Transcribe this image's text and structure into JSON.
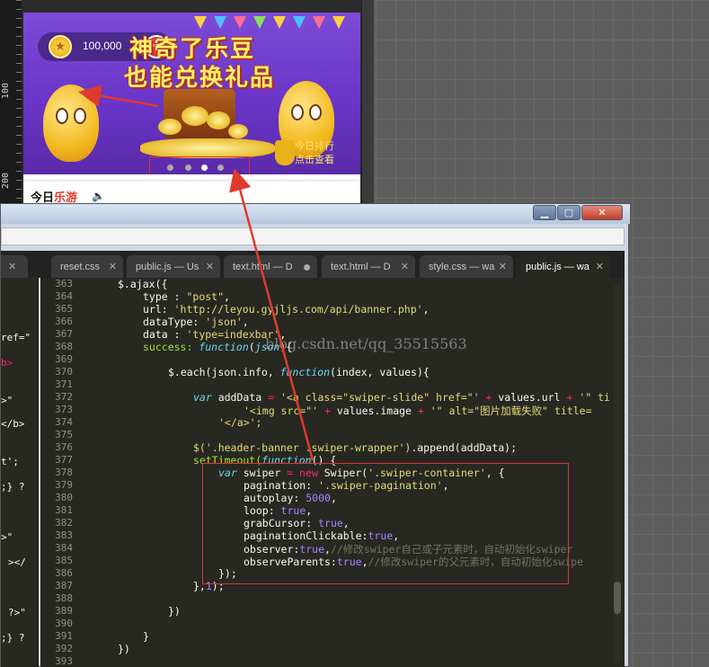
{
  "preview": {
    "ruler_labels": [
      "100",
      "200"
    ],
    "coin_value": "100,000",
    "title_line1": "神奇了乐豆",
    "title_line2": "也能兑换礼品",
    "rank_line1": "今日排行",
    "rank_line2": "点击查看",
    "logo_plain": "今日",
    "logo_red": "乐游"
  },
  "window": {
    "min_label": "▁",
    "max_label": "▢",
    "close_label": "✕"
  },
  "tabs": [
    {
      "label": "reset.css",
      "state": "close"
    },
    {
      "label": "public.js — Us",
      "state": "close"
    },
    {
      "label": "text.html — D",
      "state": "modified"
    },
    {
      "label": "text.html — D",
      "state": "close"
    },
    {
      "label": "style.css — wa",
      "state": "close"
    },
    {
      "label": "public.js — wa",
      "state": "active"
    }
  ],
  "left_fragments": [
    "ref=\"",
    "b>",
    ">\"",
    "</b>",
    "t';",
    ";} ?",
    ">\"",
    "></",
    "?>\"",
    ";} ?"
  ],
  "watermark": "blog.csdn.net/qq_35515563",
  "line_numbers": [
    "363",
    "364",
    "365",
    "366",
    "367",
    "368",
    "369",
    "370",
    "371",
    "372",
    "373",
    "374",
    "375",
    "376",
    "377",
    "378",
    "379",
    "380",
    "381",
    "382",
    "383",
    "384",
    "385",
    "386",
    "387",
    "388",
    "389",
    "390",
    "391",
    "392",
    "393"
  ],
  "code": {
    "l363": "$.ajax({",
    "l364_a": "type : ",
    "l364_b": "\"post\"",
    "l364_c": ",",
    "l365_a": "url: ",
    "l365_b": "'http://leyou.gyjljs.com/api/banner.php'",
    "l365_c": ",",
    "l366_a": "dataType: ",
    "l366_b": "'json'",
    "l366_c": ",",
    "l367_a": "data : ",
    "l367_b": "'type=indexbar'",
    "l367_c": ",",
    "l368_a": "success: ",
    "l368_b": "function",
    "l368_c": "(",
    "l368_d": "json",
    "l368_e": "){",
    "l370_a": "$.each(json.info, ",
    "l370_b": "function",
    "l370_c": "(index, values){",
    "l372_a": "var",
    "l372_b": " addData ",
    "l372_c": "=",
    "l372_d": " '<a class=\"swiper-slide\" href=\"' ",
    "l372_e": "+",
    "l372_f": " values.url ",
    "l372_g": "+",
    "l372_h": " '\" ti",
    "l373_a": "'<img src=\"' ",
    "l373_b": "+",
    "l373_c": " values.image ",
    "l373_d": "+",
    "l373_e": " '\" alt=\"图片加载失败\" title=",
    "l374": "'</a>';",
    "l376_a": "$('.header-banner .swiper-wrapper')",
    "l376_b": ".append(addData);",
    "l377_a": "setTimeout(",
    "l377_b": "function",
    "l377_c": "() {",
    "l378_a": "var",
    "l378_b": " swiper ",
    "l378_c": "=",
    "l378_d": " new",
    "l378_e": " Swiper(",
    "l378_f": "'.swiper-container'",
    "l378_g": ", {",
    "l379_a": "pagination: ",
    "l379_b": "'.swiper-pagination'",
    "l379_c": ",",
    "l380_a": "autoplay: ",
    "l380_b": "5000",
    "l380_c": ",",
    "l381_a": "loop: ",
    "l381_b": "true",
    "l381_c": ",",
    "l382_a": "grabCursor: ",
    "l382_b": "true",
    "l382_c": ",",
    "l383_a": "paginationClickable:",
    "l383_b": "true",
    "l383_c": ",",
    "l384_a": "observer:",
    "l384_b": "true",
    "l384_c": ",",
    "l384_d": "//修改swiper自己或子元素时，自动初始化swiper",
    "l385_a": "observeParents:",
    "l385_b": "true",
    "l385_c": ",",
    "l385_d": "//修改swiper的父元素时，自动初始化swipe",
    "l386": "});",
    "l387_a": "},",
    "l387_b": "1",
    "l387_c": ");",
    "l389": "})",
    "l391": "}",
    "l392": "})"
  },
  "colors": {
    "editor_bg": "#272822",
    "keyword": "#66d9ef",
    "string": "#e6db74",
    "number": "#ae81ff",
    "operator": "#f92672",
    "comment": "#75715e",
    "annotation": "#dd3333"
  }
}
